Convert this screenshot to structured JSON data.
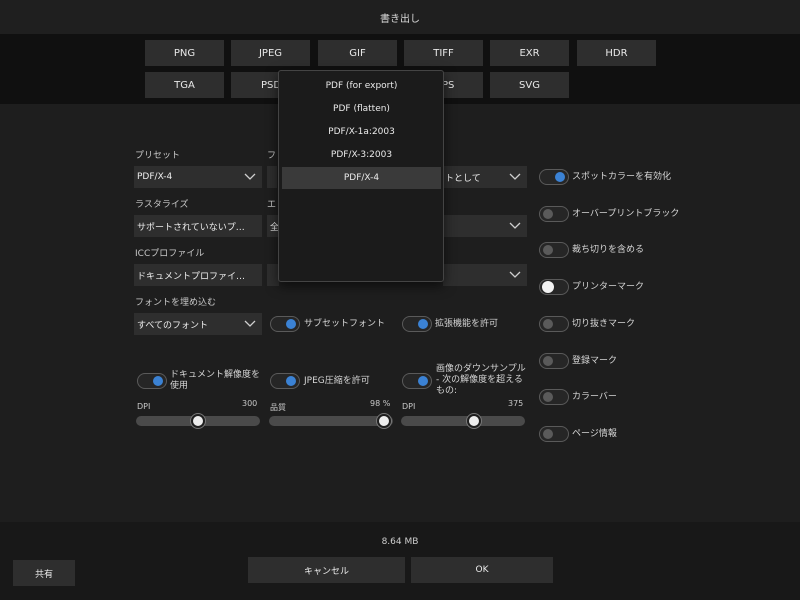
{
  "title": "書き出し",
  "formats_row1": [
    "PNG",
    "JPEG",
    "GIF",
    "TIFF",
    "EXR",
    "HDR"
  ],
  "formats_row2": [
    "TGA",
    "PSD",
    "PS",
    "SVG"
  ],
  "preset": {
    "label": "プリセット",
    "value": "PDF/X-4"
  },
  "rasterize": {
    "label": "ラスタライズ",
    "value": "サポートされていないプ…"
  },
  "icc": {
    "label": "ICCプロファイル",
    "value": "ドキュメントプロファイ…"
  },
  "embed_fonts": {
    "label": "フォントを埋め込む",
    "value": "すべてのフォント"
  },
  "col2": {
    "label1": "フ",
    "label2": "エ",
    "sel2_value": "全"
  },
  "col3": {
    "sel1_value": "トとして"
  },
  "subset_fonts": "サブセットフォント",
  "allow_extensions": "拡張機能を許可",
  "use_doc_res": {
    "label": "ドキュメント解像度を使用",
    "dpi_label": "DPI",
    "dpi_value": "300",
    "fraction": 0.5
  },
  "jpeg": {
    "label": "JPEG圧縮を許可",
    "quality_label": "品質",
    "quality_value": "98 %",
    "fraction": 0.98
  },
  "downsample": {
    "label": "画像のダウンサンプル - 次の解像度を超えるもの:",
    "dpi_label": "DPI",
    "dpi_value": "375",
    "fraction": 0.6
  },
  "right_options": [
    {
      "label": "スポットカラーを有効化",
      "state": "on"
    },
    {
      "label": "オーバープリントブラック",
      "state": "off"
    },
    {
      "label": "裁ち切りを含める",
      "state": "off"
    },
    {
      "label": "プリンターマーク",
      "state": "white"
    },
    {
      "label": "切り抜きマーク",
      "state": "off"
    },
    {
      "label": "登録マーク",
      "state": "off"
    },
    {
      "label": "カラーバー",
      "state": "off"
    },
    {
      "label": "ページ情報",
      "state": "off"
    }
  ],
  "popup_options": [
    "PDF (for export)",
    "PDF (flatten)",
    "PDF/X-1a:2003",
    "PDF/X-3:2003",
    "PDF/X-4"
  ],
  "popup_selected": 4,
  "filesize": "8.64 MB",
  "share": "共有",
  "cancel": "キャンセル",
  "ok": "OK",
  "colors": {
    "accent": "#3b82d4",
    "panel": "#1e1e1e",
    "control": "#2e2e2e"
  }
}
